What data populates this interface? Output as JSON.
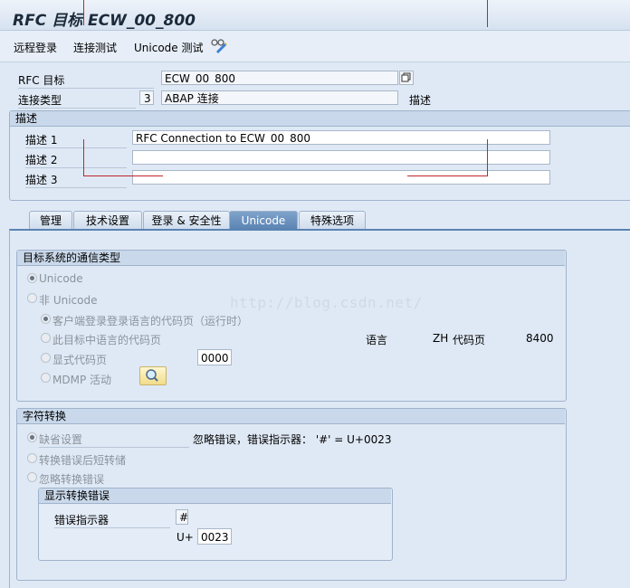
{
  "window": {
    "title": "RFC 目标 ECW_00_800"
  },
  "toolbar": {
    "remote_login": "远程登录",
    "connection_test": "连接测试",
    "unicode_test": "Unicode 测试"
  },
  "header": {
    "rfc_target_label": "RFC 目标",
    "rfc_target_value": "ECW_00_800",
    "conn_type_label": "连接类型",
    "conn_type_code": "3",
    "conn_type_value": "ABAP 连接",
    "desc_suffix": "描述"
  },
  "description": {
    "title": "描述",
    "desc1_label": "描述 1",
    "desc1_value": "RFC Connection to ECW_00_800",
    "desc2_label": "描述 2",
    "desc2_value": "",
    "desc3_label": "描述 3",
    "desc3_value": ""
  },
  "tabs": [
    "管理",
    "技术设置",
    "登录 & 安全性",
    "Unicode",
    "特殊选项"
  ],
  "active_tab": "Unicode",
  "comm_type": {
    "title": "目标系统的通信类型",
    "unicode": "Unicode",
    "non_unicode": "非 Unicode",
    "client_codepage": "客户端登录登录语言的代码页（运行时）",
    "target_lang_codepage": "此目标中语言的代码页",
    "explicit_codepage": "显式代码页",
    "explicit_codepage_value": "0000",
    "mdmp": "MDMP 活动",
    "lang_label": "语言",
    "lang_value": "ZH",
    "codepage_label": "代码页",
    "codepage_value": "8400"
  },
  "char_conv": {
    "title": "字符转换",
    "default": "缺省设置",
    "default_info": "忽略错误，错误指示器：  '#' = U+0023",
    "dump_on_error": "转换错误后短转储",
    "ignore_errors": "忽略转换错误",
    "display_title": "显示转换错误",
    "error_indicator_label": "错误指示器",
    "error_indicator_value": "#",
    "uplus_label": "U+",
    "uplus_value": "0023"
  },
  "watermark": "http://blog.csdn.net/"
}
